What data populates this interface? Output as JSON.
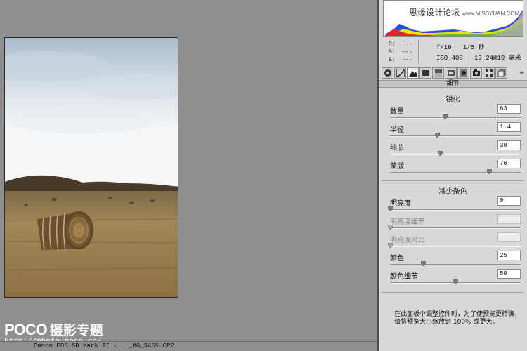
{
  "colors": {
    "panel_bg": "#d8d8d8",
    "canvas_bg": "#8f8f8f"
  },
  "watermark": {
    "brand": "POCO",
    "subtitle": "摄影专题",
    "url": "http://photo.poco.cn/"
  },
  "statusbar": {
    "camera": "Canon EOS 5D Mark II -   _MG_9465.CR2"
  },
  "histogram": {
    "site_watermark": "思缘设计论坛",
    "site_url": "www.MISSYUAN.COM"
  },
  "readout": {
    "r": "R:  ---",
    "g": "G:  ---",
    "b": "B:  ---",
    "aperture_shutter": "f/10   1/5 秒",
    "iso_focal": "ISO 400   10-24@19 毫米"
  },
  "tabs": [
    "basic-icon",
    "tone-curve-icon",
    "detail-icon",
    "hsl-icon",
    "split-toning-icon",
    "lens-icon",
    "effects-icon",
    "camera-calibration-icon",
    "presets-icon",
    "snapshots-icon"
  ],
  "section_title": "细节",
  "sharpen": {
    "title": "锐化",
    "rows": [
      {
        "label": "数量",
        "value": "63",
        "fraction": 0.42
      },
      {
        "label": "半径",
        "value": "1.4",
        "fraction": 0.36
      },
      {
        "label": "细节",
        "value": "38",
        "fraction": 0.38
      },
      {
        "label": "蒙版",
        "value": "76",
        "fraction": 0.76
      }
    ]
  },
  "noise": {
    "title": "减少杂色",
    "rows": [
      {
        "label": "明亮度",
        "value": "0",
        "fraction": 0.0,
        "dim": false
      },
      {
        "label": "明亮度细节",
        "value": "",
        "fraction": 0.0,
        "dim": true
      },
      {
        "label": "明亮度对比",
        "value": "",
        "fraction": 0.0,
        "dim": true
      },
      {
        "label": "颜色",
        "value": "25",
        "fraction": 0.25,
        "dim": false
      },
      {
        "label": "颜色细节",
        "value": "50",
        "fraction": 0.5,
        "dim": false
      }
    ]
  },
  "tip": "在此面板中调整控件时，为了使预览更精确，请将预览大小缩放到 100% 或更大。"
}
